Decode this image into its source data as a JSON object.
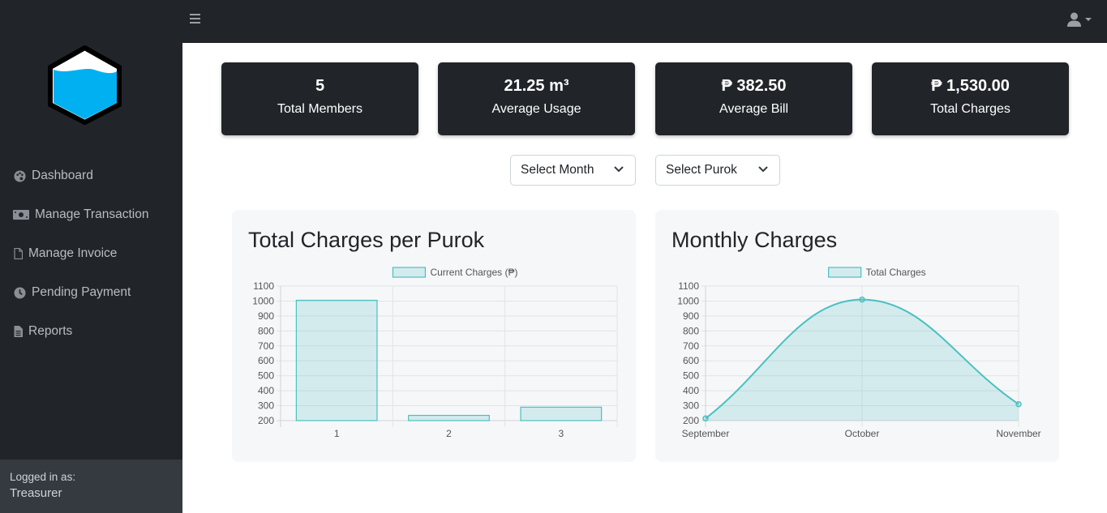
{
  "sidebar": {
    "nav": [
      {
        "label": "Dashboard",
        "icon": "palette-icon"
      },
      {
        "label": "Manage Transaction",
        "icon": "money-bill-icon"
      },
      {
        "label": "Manage Invoice",
        "icon": "file-icon"
      },
      {
        "label": "Pending Payment",
        "icon": "clock-icon"
      },
      {
        "label": "Reports",
        "icon": "file-alt-icon"
      }
    ],
    "footer": {
      "logged_in_label": "Logged in as:",
      "role": "Treasurer"
    }
  },
  "topbar": {
    "menu_icon": "bars-icon",
    "user_icon": "user-icon"
  },
  "stats": [
    {
      "value": "5",
      "label": "Total Members"
    },
    {
      "value": "21.25 m³",
      "label": "Average Usage"
    },
    {
      "value": "₱ 382.50",
      "label": "Average Bill"
    },
    {
      "value": "₱ 1,530.00",
      "label": "Total Charges"
    }
  ],
  "filters": {
    "month": {
      "value": "Select Month"
    },
    "purok": {
      "value": "Select Purok"
    }
  },
  "colors": {
    "accent": "#4bc0c0",
    "fill": "rgba(75,192,192,0.2)",
    "dark": "#212529"
  },
  "chart_data": [
    {
      "type": "bar",
      "title": "Total Charges per Purok",
      "categories": [
        "1",
        "2",
        "3"
      ],
      "series": [
        {
          "name": "Current Charges (₱)",
          "values": [
            1005,
            235,
            290
          ]
        }
      ],
      "ylim": [
        200,
        1100
      ],
      "yticks": [
        "1100",
        "1000",
        "900",
        "800",
        "700",
        "600",
        "500",
        "400",
        "300",
        "200"
      ],
      "legend": "top",
      "grid": true
    },
    {
      "type": "area",
      "title": "Monthly Charges",
      "categories": [
        "September",
        "October",
        "November"
      ],
      "series": [
        {
          "name": "Total Charges",
          "values": [
            215,
            1010,
            310
          ]
        }
      ],
      "ylim": [
        200,
        1100
      ],
      "yticks": [
        "1100",
        "1000",
        "900",
        "800",
        "700",
        "600",
        "500",
        "400",
        "300",
        "200"
      ],
      "legend": "top",
      "grid": true
    }
  ]
}
